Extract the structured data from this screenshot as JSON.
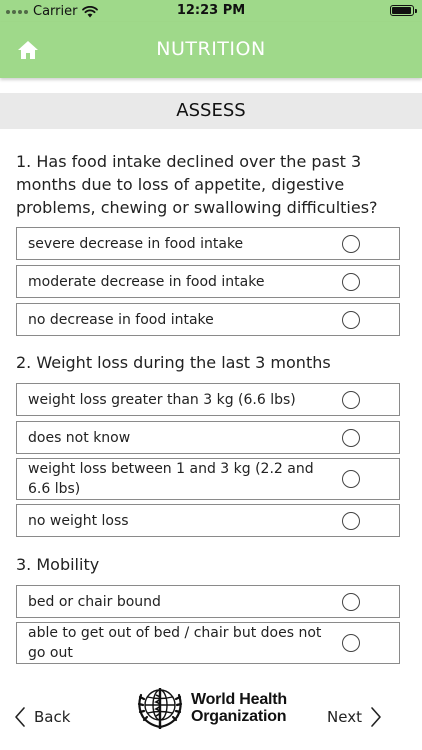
{
  "status_bar": {
    "carrier": "Carrier",
    "time": "12:23 PM",
    "battery_level": 0.95
  },
  "header": {
    "title": "NUTRITION"
  },
  "section": {
    "title": "ASSESS"
  },
  "questions": [
    {
      "text": "1. Has food intake declined over the past 3 months due to loss of appetite, digestive problems, chewing or swallowing difficulties?",
      "options": [
        {
          "label": "severe decrease in food intake"
        },
        {
          "label": "moderate decrease in food intake"
        },
        {
          "label": "no decrease in food intake"
        }
      ]
    },
    {
      "text": "2. Weight loss during the last 3 months",
      "options": [
        {
          "label": "weight loss greater than 3 kg (6.6 lbs)"
        },
        {
          "label": "does not know"
        },
        {
          "label": "weight loss between 1 and 3 kg (2.2 and 6.6 lbs)"
        },
        {
          "label": "no weight loss"
        }
      ]
    },
    {
      "text": "3. Mobility",
      "options": [
        {
          "label": "bed or chair bound"
        },
        {
          "label": "able to get out of bed / chair but does not go out"
        }
      ]
    }
  ],
  "footer": {
    "back_label": "Back",
    "next_label": "Next",
    "logo_line1": "World Health",
    "logo_line2": "Organization"
  },
  "colors": {
    "header": "#9fd98a",
    "section_bar": "#e9e9e9"
  }
}
